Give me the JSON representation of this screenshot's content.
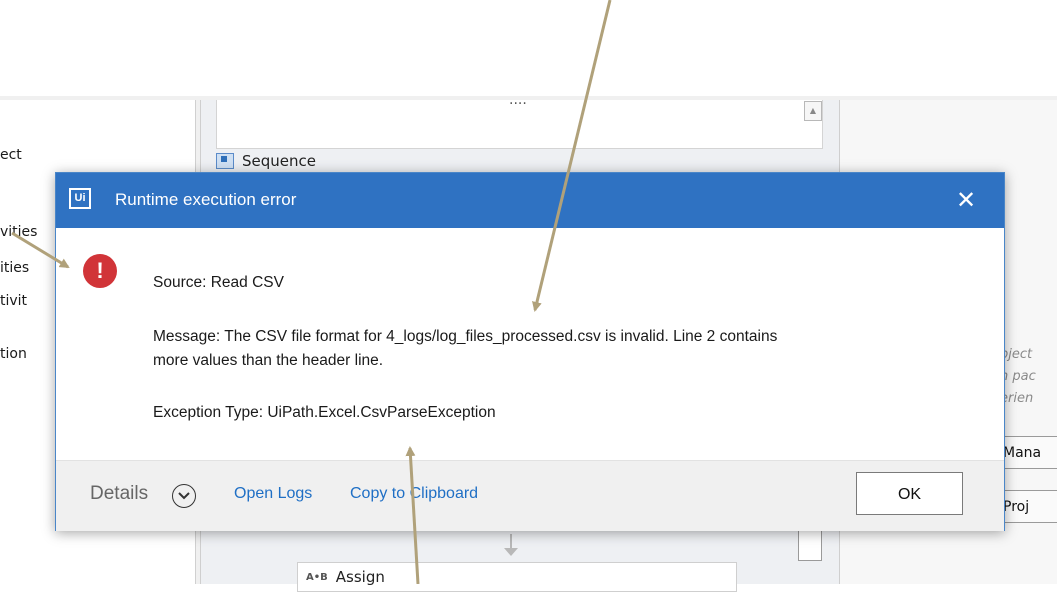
{
  "background": {
    "left_items": [
      "ect",
      "vities",
      "ities",
      "tivit",
      "tion"
    ],
    "top_box_text": "....",
    "sequence_label": "Sequence",
    "assign_label": "Assign",
    "assign_icon": "A•B",
    "right_texts": [
      "bject",
      "n pac",
      "erien"
    ],
    "right_buttons": [
      "Mana",
      "Proj"
    ]
  },
  "dialog": {
    "logo": "Ui",
    "title": "Runtime execution error",
    "close_glyph": "✕",
    "icon": "error-icon",
    "source": "Source: Read CSV",
    "message_line1": "Message: The CSV file format for 4_logs/log_files_processed.csv is invalid. Line 2 contains",
    "message_line2": "more values than the header line.",
    "exception": "Exception Type: UiPath.Excel.CsvParseException",
    "details_label": "Details",
    "open_logs": "Open Logs",
    "copy_clipboard": "Copy to Clipboard",
    "ok_label": "OK"
  },
  "colors": {
    "title_bar": "#2f72c2",
    "error_icon": "#d13438",
    "link": "#1f6fc5",
    "annotation_arrow": "#b0a17a"
  }
}
